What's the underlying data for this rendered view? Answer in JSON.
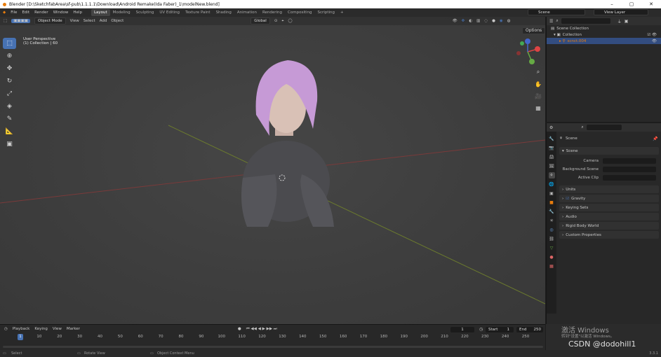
{
  "window": {
    "title": "Blender [D:\\SketchfabArea\\sf-pub\\1.1.1.1\\Download\\Android Remake(Ida Faber)_1\\modelNew.blend]",
    "controls": [
      "–",
      "▢",
      "✕"
    ]
  },
  "menu": [
    "File",
    "Edit",
    "Render",
    "Window",
    "Help"
  ],
  "workspaces": [
    "Layout",
    "Modeling",
    "Sculpting",
    "UV Editing",
    "Texture Paint",
    "Shading",
    "Animation",
    "Rendering",
    "Compositing",
    "Scripting",
    "+"
  ],
  "scene_label": "Scene",
  "view_layer_label": "View Layer",
  "viewport": {
    "mode": "Object Mode",
    "menus": [
      "View",
      "Select",
      "Add",
      "Object"
    ],
    "orientation": "Global",
    "options_label": "Options",
    "overlay_line1": "User Perspective",
    "overlay_line2": "(1) Collection | 60",
    "gizmo": {
      "x": "X",
      "y": "Y",
      "z": "Z"
    }
  },
  "tools": [
    "select-box",
    "cursor",
    "move",
    "rotate",
    "scale",
    "transform",
    "annotate",
    "measure",
    "add-cube"
  ],
  "outliner": {
    "rows": [
      {
        "label": "Scene Collection"
      },
      {
        "label": "Collection"
      },
      {
        "label": "scnct.004"
      }
    ]
  },
  "properties": {
    "title": "Scene",
    "section": "Scene",
    "camera_label": "Camera",
    "bg_label": "Background Scene",
    "clip_label": "Active Clip",
    "panels": [
      "Units",
      "Gravity",
      "Keying Sets",
      "Audio",
      "Rigid Body World",
      "Custom Properties"
    ]
  },
  "timeline": {
    "menus": [
      "Playback",
      "Keying",
      "View",
      "Marker"
    ],
    "current_frame": "1",
    "start_label": "Start",
    "start": "1",
    "end_label": "End",
    "end": "250",
    "ticks": [
      "0",
      "10",
      "20",
      "30",
      "40",
      "50",
      "60",
      "70",
      "80",
      "90",
      "100",
      "110",
      "120",
      "130",
      "140",
      "150",
      "160",
      "170",
      "180",
      "190",
      "200",
      "210",
      "220",
      "230",
      "240",
      "250"
    ],
    "playhead": "1"
  },
  "status": {
    "select": "Select",
    "rotate": "Rotate View",
    "context": "Object Context Menu",
    "version": "3.3.1"
  },
  "watermark": {
    "activate": "激活 Windows",
    "hint": "转到\"设置\"以激活 Windows。",
    "credit": "CSDN @dodohill1"
  },
  "colors": {
    "accent": "#4772b3",
    "hair": "#c69ad6"
  }
}
